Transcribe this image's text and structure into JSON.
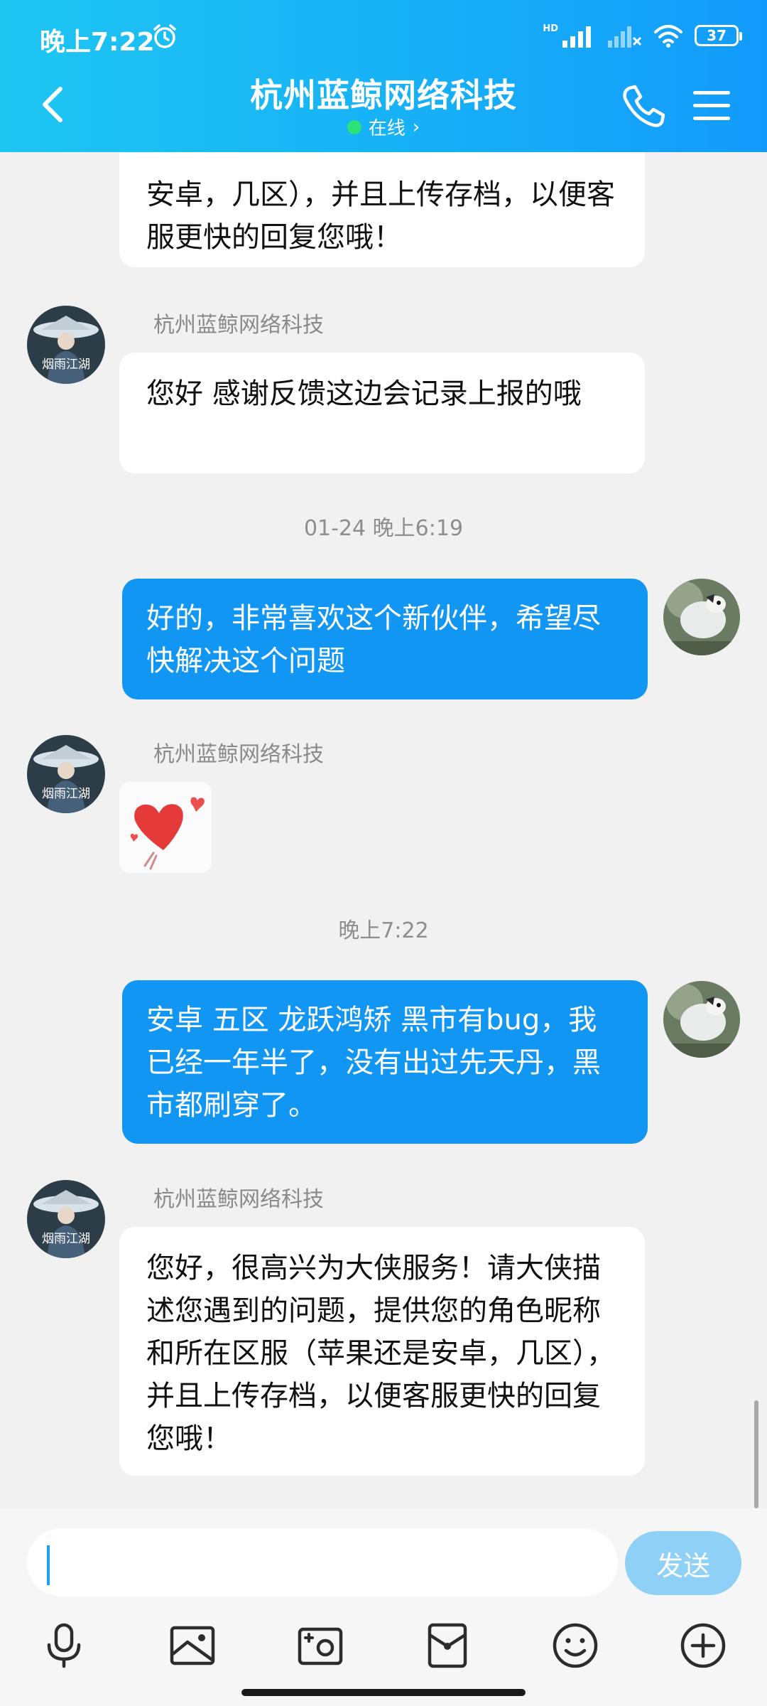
{
  "status_bar": {
    "time": "晚上7:22",
    "hd": "HD",
    "battery": "37"
  },
  "header": {
    "title": "杭州蓝鲸网络科技",
    "online": "在线",
    "online_chevron": "›"
  },
  "messages": {
    "top_partial_tail": "安卓，几区），并且上传存档，以便客服更快的回复您哦！",
    "sender_name": "杭州蓝鲸网络科技",
    "msg1_text": "您好 感谢反馈这边会记录上报的哦",
    "time1": "01-24 晚上6:19",
    "msg2_text": "好的，非常喜欢这个新伙伴，希望尽快解决这个问题",
    "time2": "晚上7:22",
    "msg3_text": "安卓 五区 龙跃鸿矫 黑市有bug，我已经一年半了，没有出过先天丹，黑市都刷穿了。",
    "msg4_text": "您好，很高兴为大侠服务！请大侠描述您遇到的问题，提供您的角色昵称和所在区服（苹果还是安卓，几区），并且上传存档，以便客服更快的回复您哦！",
    "avatar_caption": "烟雨江湖"
  },
  "input": {
    "placeholder": "",
    "send_label": "发送"
  },
  "toolbar_icons": [
    "microphone-icon",
    "image-icon",
    "camera-icon",
    "red-packet-icon",
    "emoji-icon",
    "plus-icon"
  ],
  "colors": {
    "header_start": "#1ec6f2",
    "header_end": "#129bfb",
    "bubble_out": "#1196f3",
    "send_disabled": "#8fd0f7"
  }
}
